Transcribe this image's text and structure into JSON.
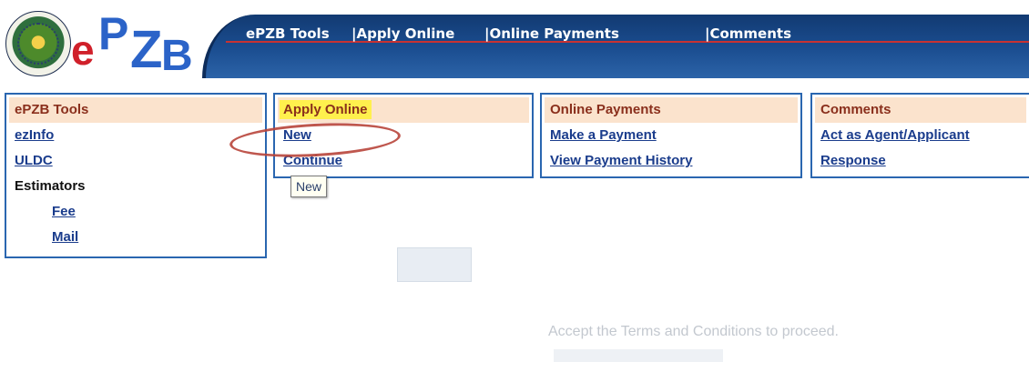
{
  "app": {
    "logo": {
      "e": "e",
      "p": "P",
      "z": "Z",
      "b": "B"
    }
  },
  "nav": {
    "items": [
      {
        "label": "ePZB Tools"
      },
      {
        "label": "|Apply Online"
      },
      {
        "label": "|Online Payments"
      },
      {
        "label": "|Comments"
      }
    ]
  },
  "panels": {
    "tools": {
      "title": "ePZB Tools",
      "ezinfo": "ezInfo",
      "uldc": "ULDC",
      "estimators": "Estimators",
      "fee": "Fee",
      "mail": "Mail"
    },
    "apply": {
      "title": "Apply Online",
      "new": "New",
      "continue": "Continue"
    },
    "payments": {
      "title": "Online Payments",
      "make": "Make a Payment",
      "history": "View Payment History"
    },
    "comments": {
      "title": "Comments",
      "agent": "Act as Agent/Applicant",
      "response": "Response"
    }
  },
  "tooltip": {
    "text": "New"
  },
  "background": {
    "terms": "Accept the Terms and Conditions to proceed."
  },
  "colors": {
    "nav_bg": "#1b4e91",
    "panel_border": "#2a66b0",
    "panel_header_bg": "#fbe3cd",
    "link": "#1a3c8c",
    "highlight": "#fff04d",
    "annotation": "#b8453b"
  }
}
